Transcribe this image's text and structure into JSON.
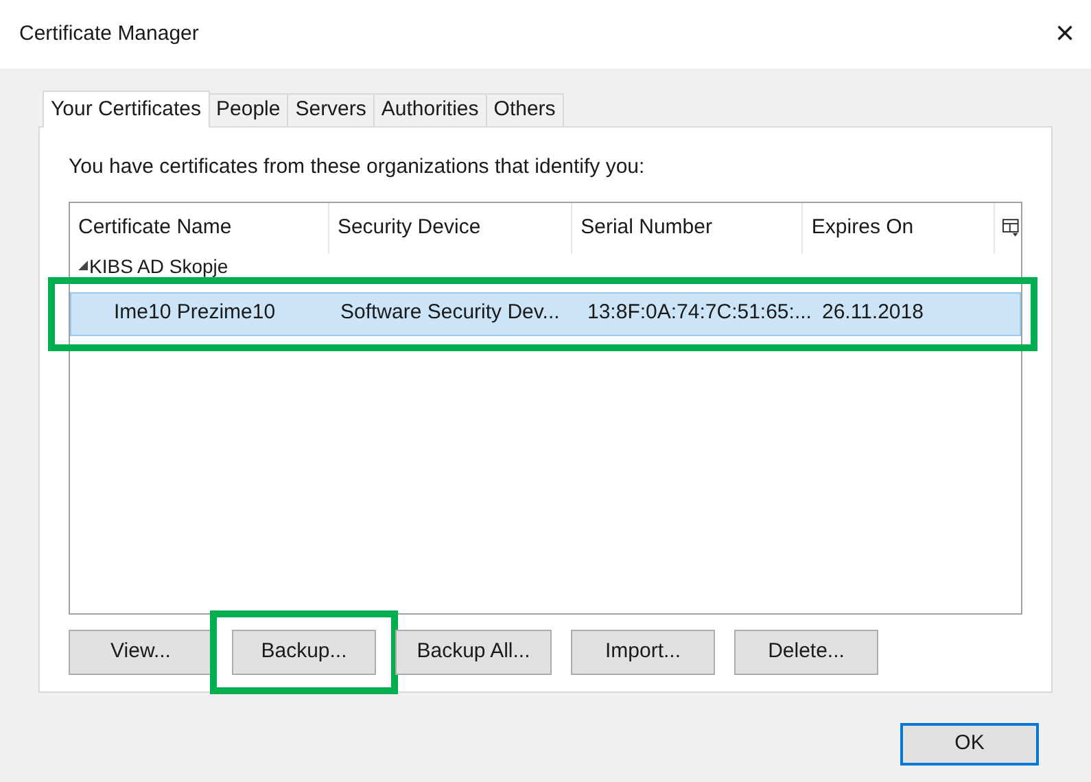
{
  "window": {
    "title": "Certificate Manager",
    "close": "×"
  },
  "tabs": [
    {
      "label": "Your Certificates",
      "selected": true
    },
    {
      "label": "People",
      "selected": false
    },
    {
      "label": "Servers",
      "selected": false
    },
    {
      "label": "Authorities",
      "selected": false
    },
    {
      "label": "Others",
      "selected": false
    }
  ],
  "intro": "You have certificates from these organizations that identify you:",
  "table": {
    "columns": [
      "Certificate Name",
      "Security Device",
      "Serial Number",
      "Expires On"
    ],
    "groups": [
      {
        "name": "KIBS AD Skopje",
        "expanded": true,
        "rows": [
          {
            "cells": [
              "Ime10 Prezime10",
              "Software Security Dev...",
              "13:8F:0A:74:7C:51:65:...",
              "26.11.2018"
            ],
            "selected": true,
            "highlighted": true
          }
        ]
      }
    ]
  },
  "buttons": [
    {
      "label": "View...",
      "highlighted": false
    },
    {
      "label": "Backup...",
      "highlighted": true
    },
    {
      "label": "Backup All...",
      "highlighted": false
    },
    {
      "label": "Import...",
      "highlighted": false
    },
    {
      "label": "Delete...",
      "highlighted": false
    }
  ],
  "ok_button": {
    "label": "OK",
    "focused": true
  }
}
